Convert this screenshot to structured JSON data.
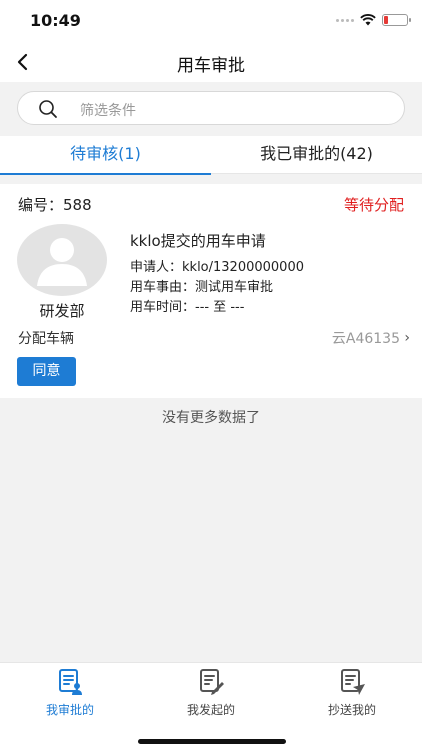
{
  "status_bar": {
    "time": "10:49",
    "battery_color": "#e53935"
  },
  "nav": {
    "title": "用车审批",
    "back_icon": "chevron-left-icon"
  },
  "search": {
    "placeholder": "筛选条件",
    "icon": "search-icon"
  },
  "tabs": [
    {
      "label": "待审核(1)",
      "active": true
    },
    {
      "label": "我已审批的(42)",
      "active": false
    }
  ],
  "request": {
    "code_label": "编号：",
    "code": "588",
    "status": "等待分配",
    "department": "研发部",
    "title": "kklo提交的用车申请",
    "applicant_label": "申请人：",
    "applicant": "kklo/13200000000",
    "reason_label": "用车事由：",
    "reason": "测试用车审批",
    "time_label": "用车时间：",
    "time": "--- 至 ---",
    "assign_label": "分配车辆",
    "assign_value": "云A46135",
    "approve_label": "同意"
  },
  "list_footer": "没有更多数据了",
  "tabbar": [
    {
      "label": "我审批的",
      "icon": "approval-list-icon",
      "active": true
    },
    {
      "label": "我发起的",
      "icon": "edit-document-icon",
      "active": false
    },
    {
      "label": "抄送我的",
      "icon": "send-document-icon",
      "active": false
    }
  ],
  "colors": {
    "accent": "#1e7cd4",
    "status_red": "#e02020"
  }
}
